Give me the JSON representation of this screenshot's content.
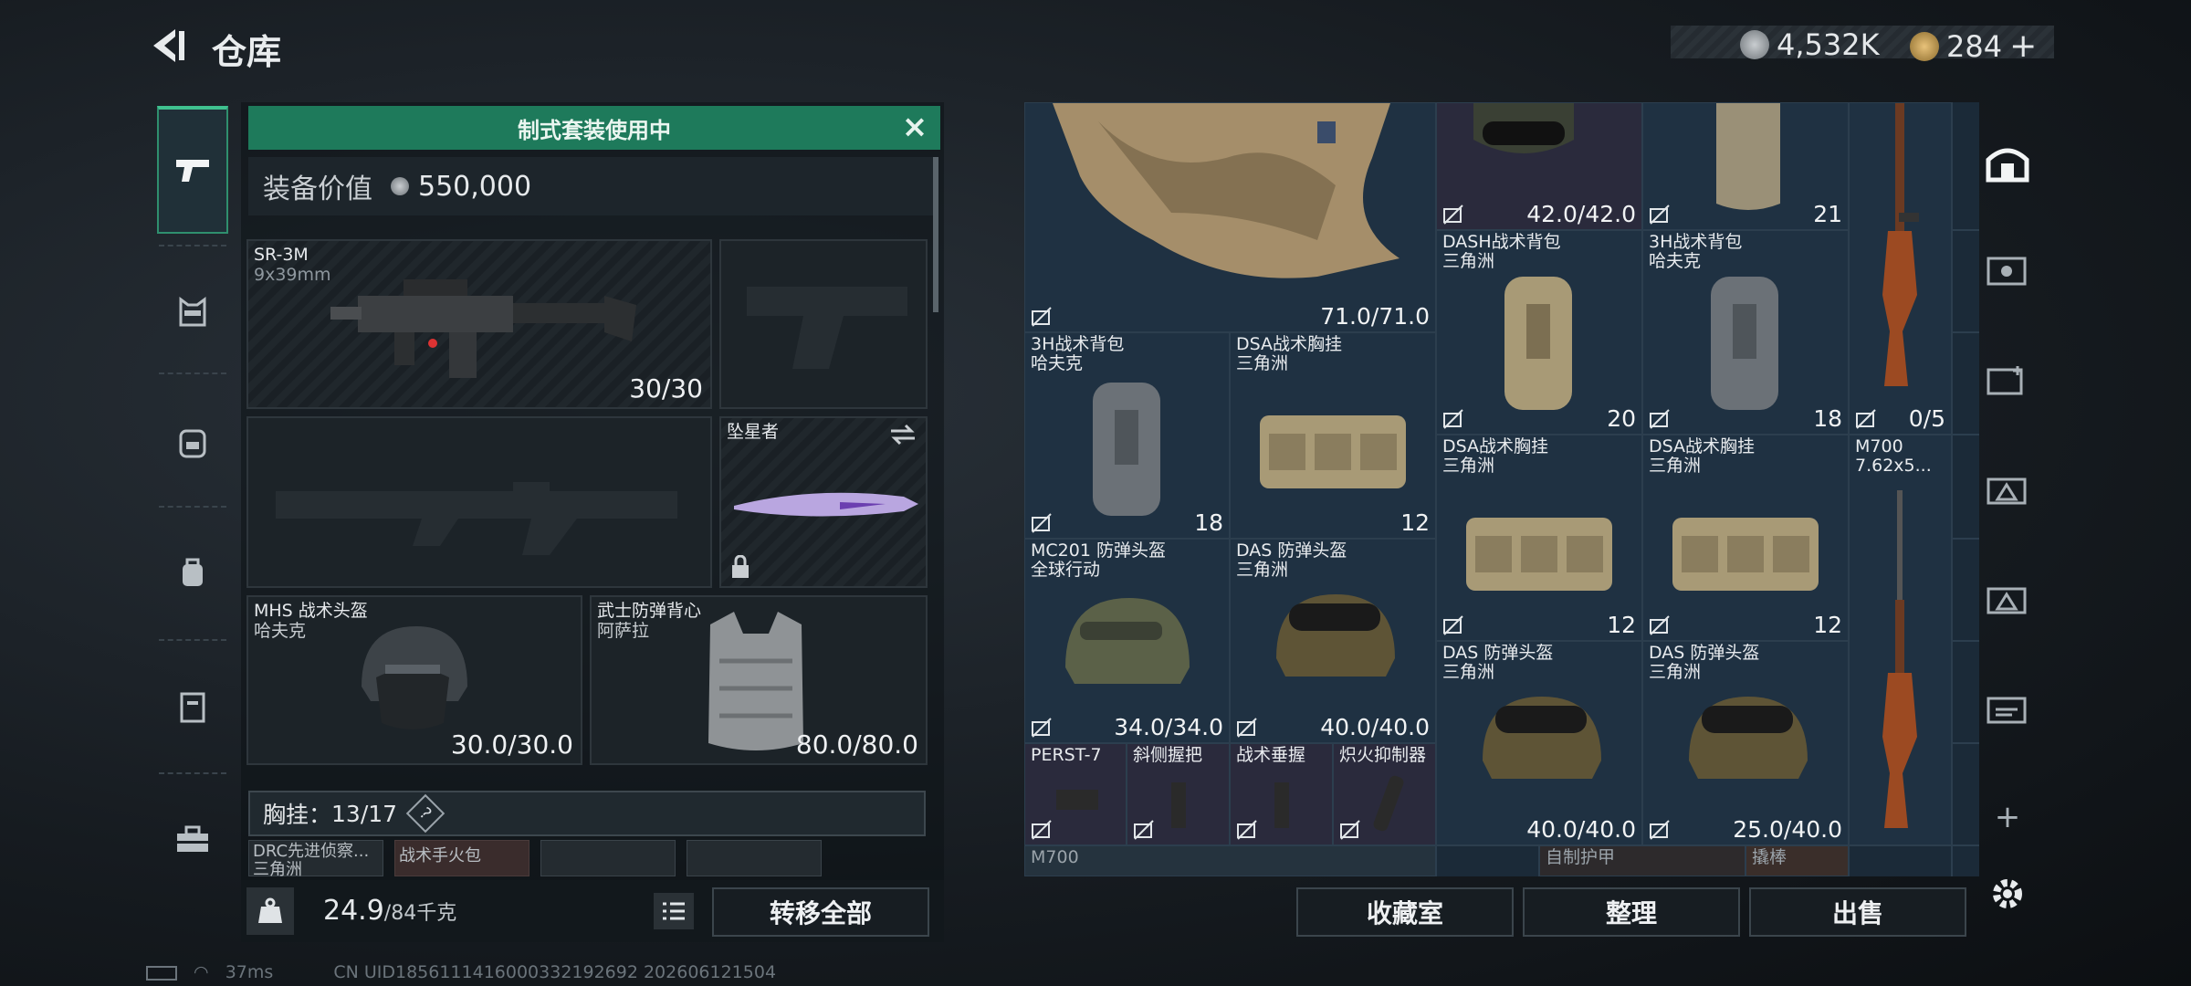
{
  "header": {
    "title": "仓库"
  },
  "currency": {
    "silver": "4,532K",
    "gold": "284",
    "add": "+"
  },
  "banner": {
    "text": "制式套装使用中"
  },
  "equip_value": {
    "label": "装备价值",
    "value": "550,000"
  },
  "slots": {
    "primary": {
      "name": "SR-3M",
      "ammo": "9x39mm",
      "count": "30/30"
    },
    "melee": {
      "name": "坠星者"
    },
    "helmet": {
      "name": "MHS 战术头盔",
      "map": "哈夫克",
      "durability": "30.0/30.0"
    },
    "armor": {
      "name": "武士防弹背心",
      "map": "阿萨拉",
      "durability": "80.0/80.0"
    }
  },
  "chest_rig": {
    "label": "胸挂：",
    "count": "13/17",
    "help": "?"
  },
  "rig_items": [
    "DRC先进侦察...",
    "三角洲",
    "战术手火包"
  ],
  "weight": {
    "current": "24.9",
    "max": "/84千克"
  },
  "buttons": {
    "transfer_all": "转移全部",
    "collection": "收藏室",
    "organize": "整理",
    "sell": "出售"
  },
  "grid": {
    "vest_durability": "71.0/71.0",
    "helmet_top_durability": "42.0/42.0",
    "bag_top_count": "21",
    "rifle_top_ammo": "0/5",
    "items": [
      {
        "name": "DASH战术背包",
        "map": "三角洲",
        "count": "20"
      },
      {
        "name": "3H战术背包",
        "map": "哈夫克",
        "count": "18"
      },
      {
        "name": "3H战术背包",
        "map": "哈夫克",
        "count": "18"
      },
      {
        "name": "DSA战术胸挂",
        "map": "三角洲",
        "count": "12"
      },
      {
        "name": "DSA战术胸挂",
        "map": "三角洲",
        "count": "12"
      },
      {
        "name": "DSA战术胸挂",
        "map": "三角洲",
        "count": "12"
      },
      {
        "name": "MC201 防弹头盔",
        "map": "全球行动",
        "count": "34.0/34.0"
      },
      {
        "name": "DAS 防弹头盔",
        "map": "三角洲",
        "count": "40.0/40.0"
      },
      {
        "name": "DAS 防弹头盔",
        "map": "三角洲",
        "count": "40.0/40.0"
      },
      {
        "name": "DAS 防弹头盔",
        "map": "三角洲",
        "count": "25.0/40.0"
      }
    ],
    "rifle2": {
      "name": "M700",
      "ammo": "7.62x5..."
    },
    "attachments": [
      "PERST-7",
      "斜侧握把",
      "战术垂握",
      "炽火抑制器"
    ],
    "bottom_row": [
      "M700",
      "自制护甲",
      "撬棒"
    ]
  },
  "footer": {
    "ping": "37ms",
    "uid": "CN UID1856111416000332192692 202606121504"
  },
  "colors": {
    "accent": "#1e7a5b",
    "grid_bg": "#1f3142"
  }
}
